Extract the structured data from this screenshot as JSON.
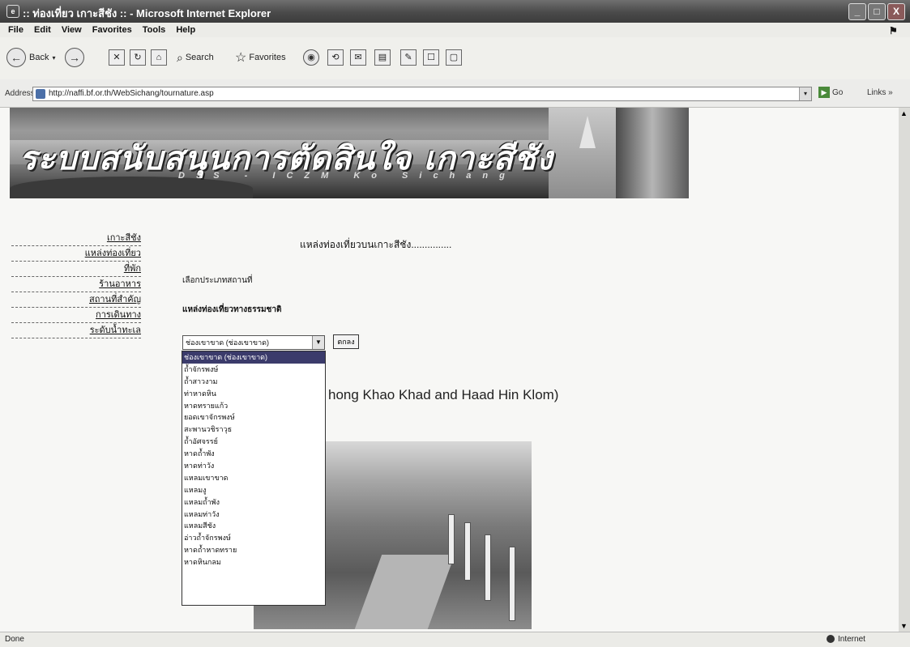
{
  "window": {
    "title": ":: ท่องเที่ยว เกาะสีชัง :: - Microsoft Internet Explorer",
    "buttons": [
      "_",
      "□",
      "X"
    ]
  },
  "menubar": [
    "File",
    "Edit",
    "View",
    "Favorites",
    "Tools",
    "Help"
  ],
  "toolbar": {
    "back": "Back",
    "search": "Search",
    "favorites": "Favorites"
  },
  "address": {
    "label": "Address",
    "url": "http://naffi.bf.or.th/WebSichang/tournature.asp",
    "go": "Go",
    "links": "Links"
  },
  "banner": {
    "title": "ระบบสนับสนุนการตัดสินใจ เกาะสีชัง",
    "subtitle": "DSS - ICZM Ko Sichang"
  },
  "nav": {
    "items": [
      "เกาะสีชัง",
      "แหล่งท่องเที่ยว",
      "ที่พัก",
      "ร้านอาหาร",
      "สถานที่สำคัญ",
      "การเดินทาง",
      "ระดับน้ำทะเล"
    ]
  },
  "main": {
    "heading": "แหล่งท่องเที่ยวบนเกาะสีชัง...............",
    "label_type": "เลือกประเภทสถานที่",
    "label_nature": "แหล่งท่องเที่ยวทางธรรมชาติ",
    "select_value": "ช่องเขาขาด (ช่องเขาขาด)",
    "button_label": "ตกลง",
    "options": [
      "ช่องเขาขาด (ช่องเขาขาด)",
      "ถ้ำจักรพงษ์",
      "ถ้ำสาวงาม",
      "ท่าหาดหิน",
      "หาดทรายแก้ว",
      "ยอดเขาจักรพงษ์",
      "สะพานวชิราวุธ",
      "ถ้ำอัศจรรย์",
      "หาดถ้ำพัง",
      "หาดท่าวัง",
      "แหลมเขาขาด",
      "แหลมงู",
      "แหลมถ้ำพัง",
      "แหลมท่าวัง",
      "แหลมสีชัง",
      "อ่าวถ้ำจักรพงษ์",
      "หาดถ้ำหาดทราย",
      "หาดหินกลม"
    ],
    "caption": "hong Khao Khad and Haad Hin Klom)"
  },
  "statusbar": {
    "left": "Done",
    "right": "Internet"
  }
}
